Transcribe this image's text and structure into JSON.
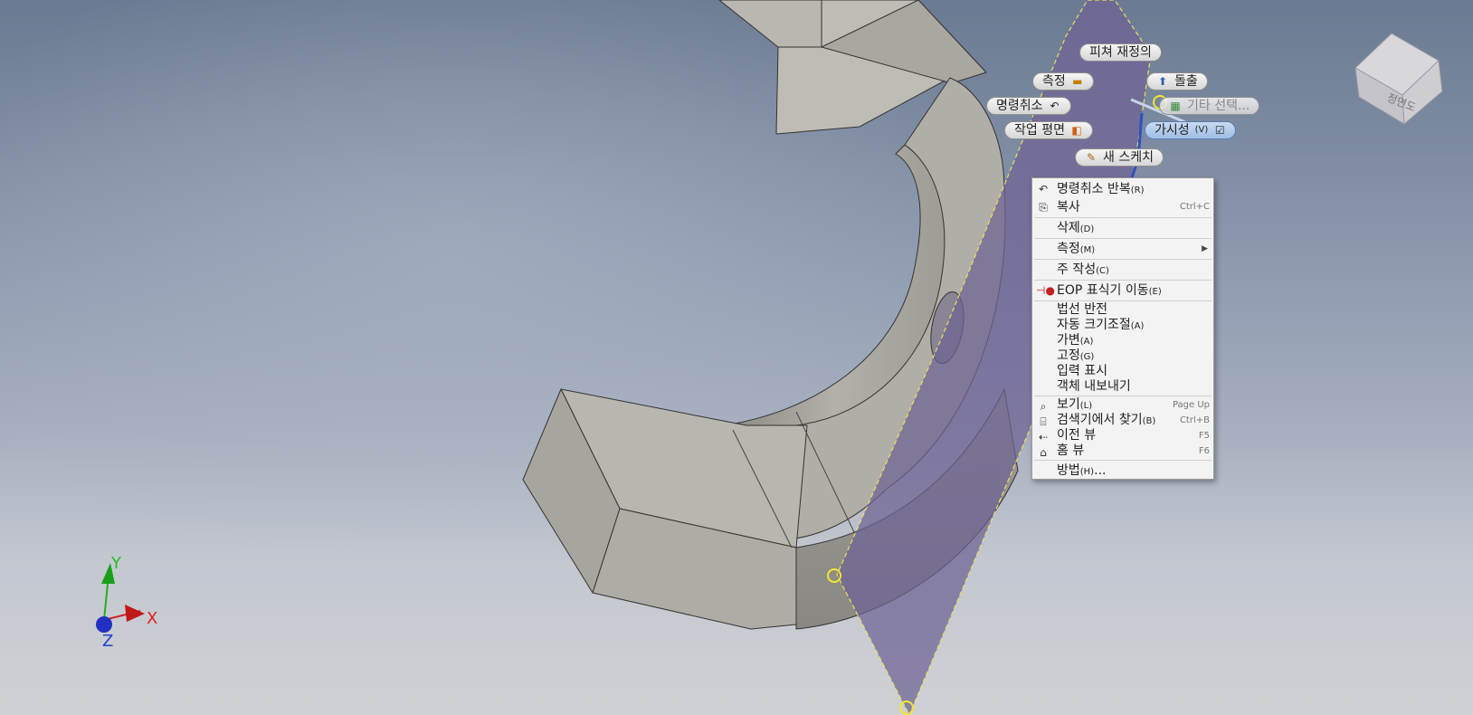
{
  "marking_menu": {
    "feature_redefine": "피쳐 재정의",
    "measure": "측정",
    "extrude": "돌출",
    "undo": "명령취소",
    "more_select": "기타 선택...",
    "work_plane": "작업 평면",
    "visibility": "가시성",
    "visibility_key": "(V)",
    "new_sketch": "새 스케치"
  },
  "context_menu": {
    "items": [
      {
        "label": "명령취소 반복",
        "key": "(R)",
        "shortcut": "",
        "icon": "undo-icon"
      },
      {
        "label": "복사",
        "key": "",
        "shortcut": "Ctrl+C",
        "icon": "copy-icon"
      },
      {
        "label": "삭제",
        "key": "(D)",
        "shortcut": "",
        "icon": ""
      },
      {
        "label": "측정",
        "key": "(M)",
        "shortcut": "",
        "icon": "",
        "submenu": true
      },
      {
        "label": "주 작성",
        "key": "(C)",
        "shortcut": "",
        "icon": ""
      },
      {
        "label": "EOP 표식기 이동",
        "key": "(E)",
        "shortcut": "",
        "icon": "eop-icon"
      },
      {
        "label": "법선 반전",
        "key": "",
        "shortcut": ""
      },
      {
        "label": "자동 크기조절",
        "key": "(A)",
        "shortcut": ""
      },
      {
        "label": "가변",
        "key": "(A)",
        "shortcut": ""
      },
      {
        "label": "고정",
        "key": "(G)",
        "shortcut": ""
      },
      {
        "label": "입력 표시",
        "key": "",
        "shortcut": ""
      },
      {
        "label": "객체 내보내기",
        "key": "",
        "shortcut": ""
      },
      {
        "label": "보기",
        "key": "(L)",
        "shortcut": "Page Up",
        "icon": "zoom-icon"
      },
      {
        "label": "검색기에서 찾기",
        "key": "(B)",
        "shortcut": "Ctrl+B",
        "icon": "find-icon"
      },
      {
        "label": "이전 뷰",
        "key": "",
        "shortcut": "F5",
        "icon": "previous-view-icon"
      },
      {
        "label": "홈 뷰",
        "key": "",
        "shortcut": "F6",
        "icon": "home-icon"
      },
      {
        "label": "방법",
        "key": "(H)",
        "suffix": "...",
        "shortcut": ""
      }
    ]
  },
  "viewcube": {
    "face_label": "정면도"
  },
  "triad": {
    "x": "X",
    "y": "Y",
    "z": "Z"
  },
  "colors": {
    "plane": "#6e6294",
    "part_face": "#b6b4ac",
    "axis_x": "#d02020",
    "axis_y": "#20b020",
    "axis_z": "#2030c0"
  }
}
